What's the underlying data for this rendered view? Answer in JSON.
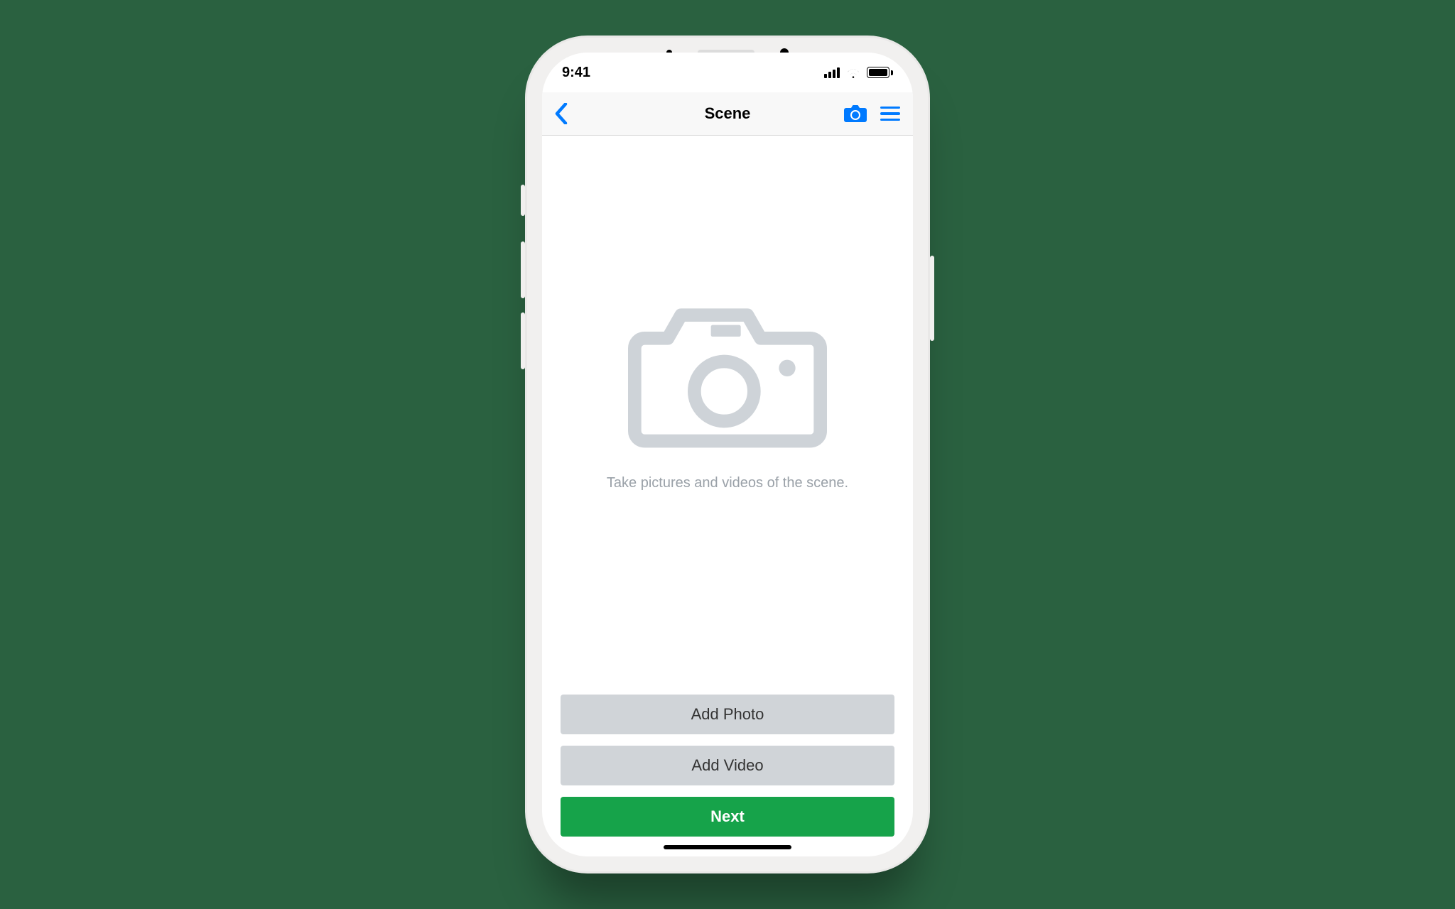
{
  "status": {
    "time": "9:41"
  },
  "nav": {
    "title": "Scene",
    "back_icon": "chevron-left",
    "camera_icon": "camera",
    "menu_icon": "menu"
  },
  "content": {
    "placeholder_icon": "camera-outline",
    "hint": "Take pictures and videos of the scene."
  },
  "actions": {
    "add_photo": "Add Photo",
    "add_video": "Add Video",
    "next": "Next"
  },
  "colors": {
    "accent": "#007aff",
    "primary_button": "#16a34a",
    "secondary_button": "#d0d4d8",
    "background": "#2a6140"
  }
}
